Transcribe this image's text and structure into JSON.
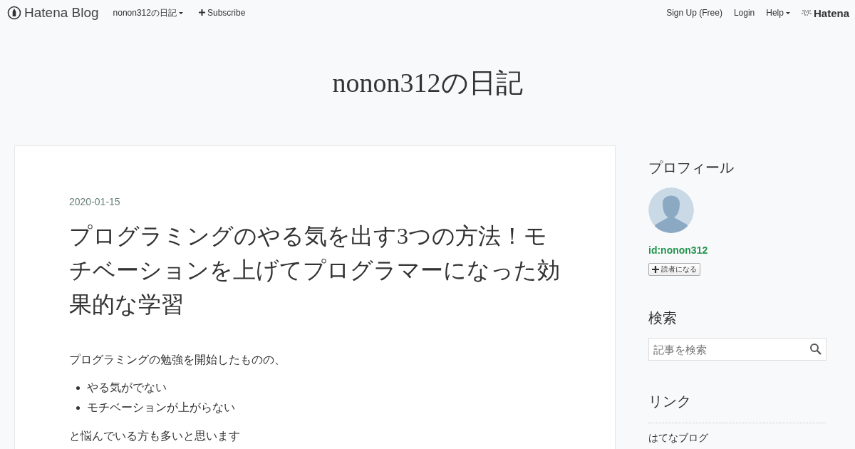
{
  "header": {
    "logo": "Hatena Blog",
    "blog_menu": "nonon312の日記",
    "subscribe": "Subscribe",
    "links": [
      {
        "label": "Sign Up (Free)",
        "kind": "link"
      },
      {
        "label": "Login",
        "kind": "link"
      },
      {
        "label": "Help",
        "kind": "dropdown"
      }
    ],
    "brand": "Hatena"
  },
  "blog_title": "nonon312の日記",
  "entry": {
    "date": "2020-01-15",
    "title": "プログラミングのやる気を出す3つの方法！モチベーションを上げてプログラマーになった効果的な学習",
    "paragraphs_before": [
      "プログラミングの勉強を開始したものの、"
    ],
    "bullets": [
      "やる気がでない",
      "モチベーションが上がらない"
    ],
    "paragraphs_after": [
      "と悩んでいる方も多いと思います"
    ]
  },
  "sidebar": {
    "profile": {
      "heading": "プロフィール",
      "user_id": "id:nonon312",
      "follow_button": "読者になる"
    },
    "search": {
      "heading": "検索",
      "placeholder": "記事を検索"
    },
    "links": {
      "heading": "リンク",
      "items": [
        "はてなブログ"
      ]
    }
  }
}
